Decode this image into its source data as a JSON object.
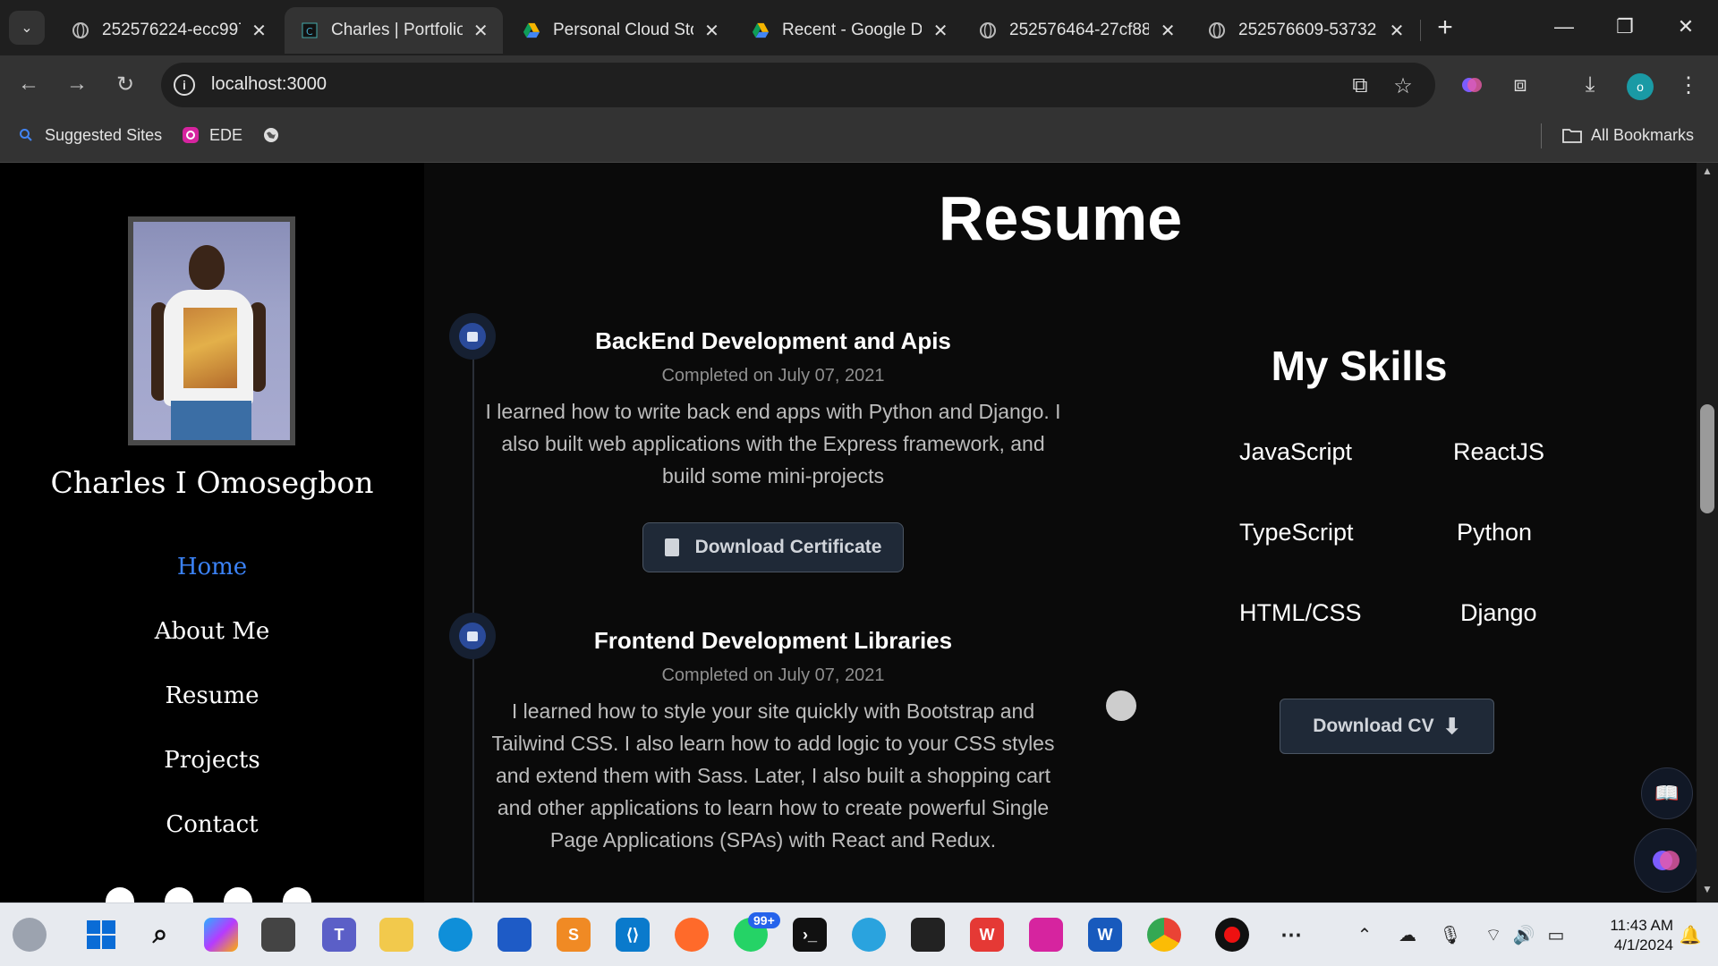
{
  "browser": {
    "tabs": [
      {
        "title": "252576224-ecc997",
        "active": false,
        "icon": "globe-icon"
      },
      {
        "title": "Charles | Portfolio",
        "active": true,
        "icon": "portfolio-favicon-icon"
      },
      {
        "title": "Personal Cloud Sto",
        "active": false,
        "icon": "google-drive-icon"
      },
      {
        "title": "Recent - Google D",
        "active": false,
        "icon": "google-drive-icon"
      },
      {
        "title": "252576464-27cf88",
        "active": false,
        "icon": "globe-icon"
      },
      {
        "title": "252576609-53732",
        "active": false,
        "icon": "globe-icon"
      }
    ],
    "url": "localhost:3000",
    "bookmarks": [
      {
        "label": "Suggested Sites",
        "icon": "search-icon"
      },
      {
        "label": "EDE",
        "icon": "instagram-icon"
      },
      {
        "label": "",
        "icon": "globe-icon"
      }
    ],
    "all_bookmarks_label": "All Bookmarks",
    "profile_initial": "o"
  },
  "sidebar": {
    "name": "Charles I Omosegbon",
    "nav": [
      {
        "label": "Home",
        "active": true
      },
      {
        "label": "About Me",
        "active": false
      },
      {
        "label": "Resume",
        "active": false
      },
      {
        "label": "Projects",
        "active": false
      },
      {
        "label": "Contact",
        "active": false
      }
    ],
    "social_icons": [
      "github-icon",
      "instagram-icon",
      "linkedin-icon",
      "twitter-icon"
    ]
  },
  "main": {
    "title": "Resume",
    "entries": [
      {
        "title": "BackEnd Development and Apis",
        "date": "Completed on July 07, 2021",
        "description": "I learned how to write back end apps with Python and Django. I also built web applications with the Express framework, and build some mini-projects",
        "button_label": "Download Certificate"
      },
      {
        "title": "Frontend Development Libraries",
        "date": "Completed on July 07, 2021",
        "description": "I learned how to style your site quickly with Bootstrap and Tailwind CSS. I also learn how to add logic to your CSS styles and extend them with Sass. Later, I also built a shopping cart and other applications to learn how to create powerful Single Page Applications (SPAs) with React and Redux."
      }
    ],
    "skills_title": "My Skills",
    "skills": [
      "JavaScript",
      "ReactJS",
      "TypeScript",
      "Python",
      "HTML/CSS",
      "Django"
    ],
    "cv_button_label": "Download CV"
  },
  "taskbar": {
    "whatsapp_badge": "99+",
    "time": "11:43 AM",
    "date": "4/1/2024"
  }
}
